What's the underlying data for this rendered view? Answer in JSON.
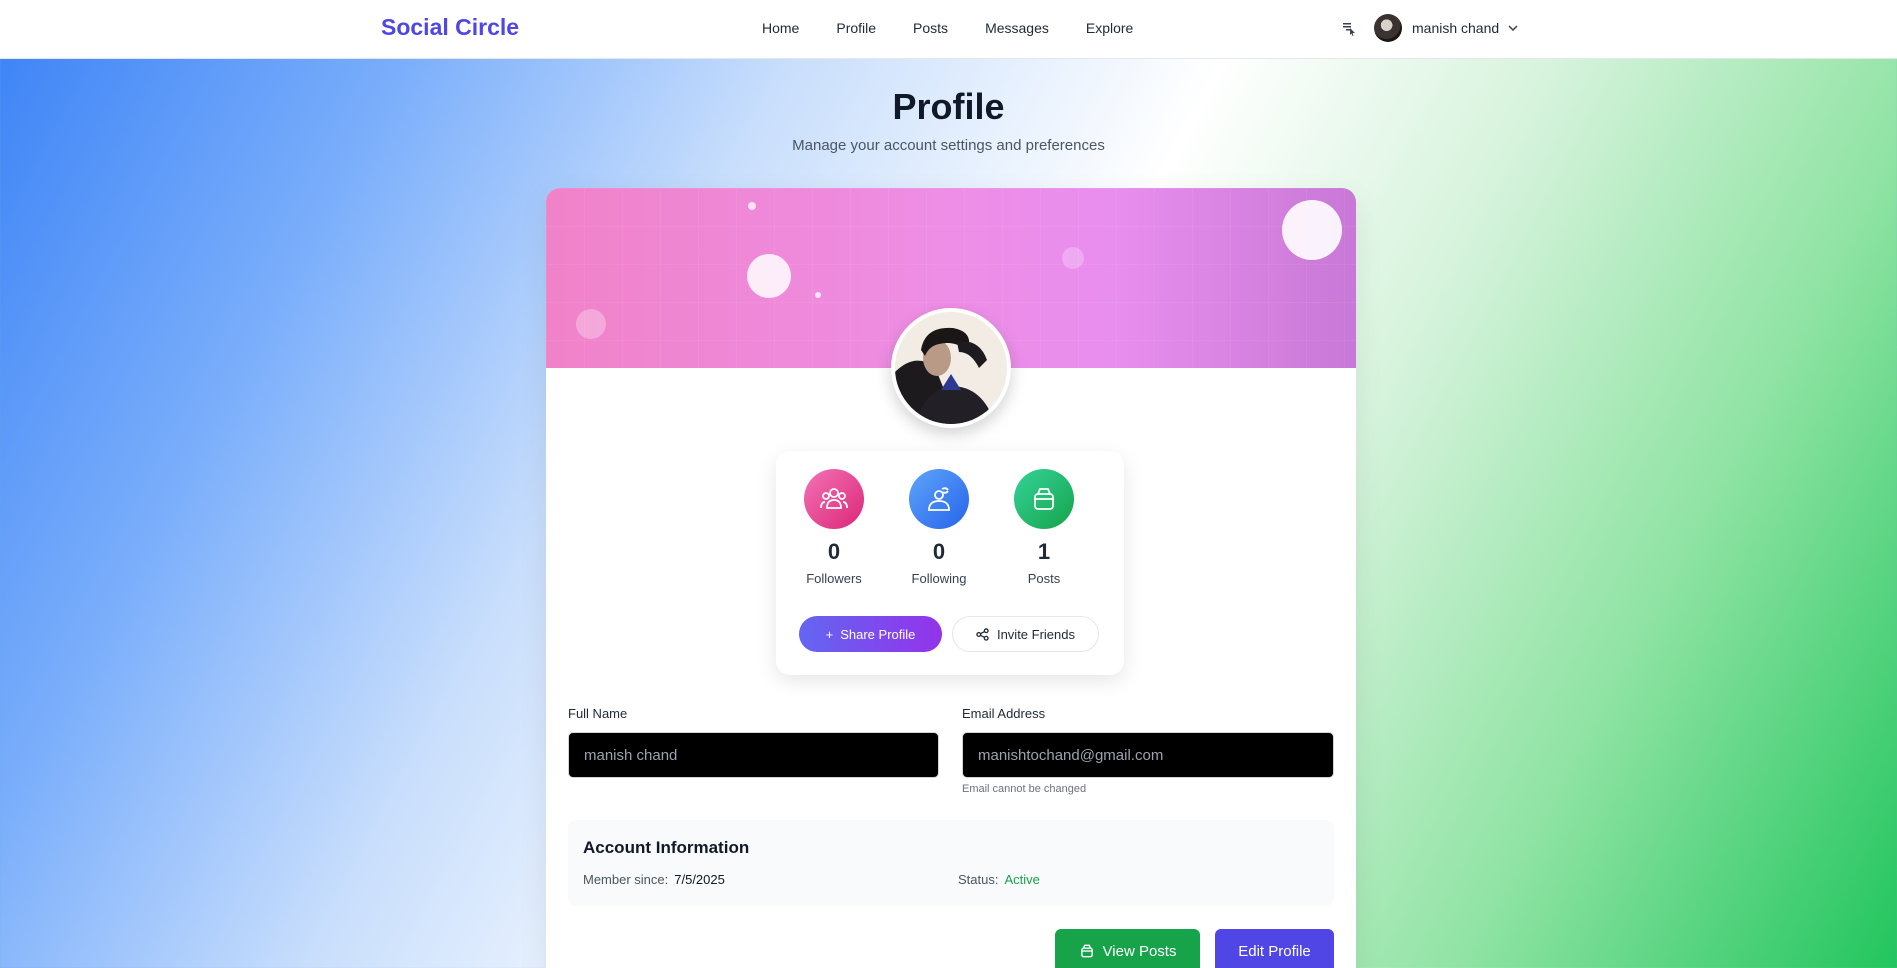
{
  "app": {
    "brand": "Social Circle"
  },
  "nav": {
    "links": [
      {
        "label": "Home"
      },
      {
        "label": "Profile"
      },
      {
        "label": "Posts"
      },
      {
        "label": "Messages"
      },
      {
        "label": "Explore"
      }
    ],
    "user_name": "manish chand"
  },
  "header": {
    "title": "Profile",
    "subtitle": "Manage your account settings and preferences"
  },
  "stats": [
    {
      "value": "0",
      "label": "Followers",
      "color": "#ec4899",
      "icon": "users-icon"
    },
    {
      "value": "0",
      "label": "Following",
      "color": "#3b82f6",
      "icon": "user-follow-icon"
    },
    {
      "value": "1",
      "label": "Posts",
      "color": "#22c55e",
      "icon": "box-icon"
    }
  ],
  "actions": {
    "share_label": "Share Profile",
    "invite_label": "Invite Friends"
  },
  "form": {
    "full_name_label": "Full Name",
    "full_name_placeholder": "manish chand",
    "email_label": "Email Address",
    "email_placeholder": "manishtochand@gmail.com",
    "email_hint": "Email cannot be changed"
  },
  "account": {
    "title": "Account Information",
    "member_since_label": "Member since:",
    "member_since_value": "7/5/2025",
    "status_label": "Status:",
    "status_value": "Active",
    "status_color": "#16a34a"
  },
  "buttons": {
    "view_posts": "View Posts",
    "edit_profile": "Edit Profile"
  },
  "colors": {
    "brand": "#4f46e5",
    "banner_start": "#f082c8",
    "banner_end": "#c878d6",
    "view_posts": "#16a34a",
    "edit_profile": "#4f46e5"
  }
}
